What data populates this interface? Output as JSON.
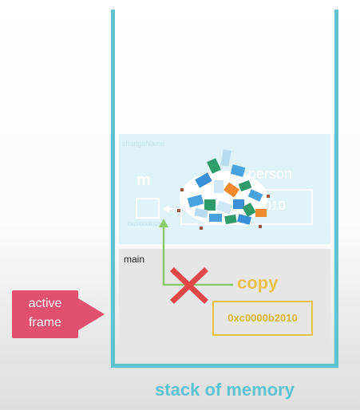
{
  "diagram": {
    "caption": "stack of memory",
    "active_frame_label": "active\nframe",
    "main_frame": {
      "label": "main",
      "variable": "copy",
      "value": "0xc0000b2010"
    },
    "upper_frame": {
      "label": "changeName",
      "param": "m",
      "param_addr": "0xc0000b2010",
      "target": "person",
      "target_value": "0xc0000b2010",
      "target_value_visible": "2010"
    },
    "colors": {
      "stack_wall": "#5fc2d2",
      "upper_frame_bg": "#dcf1f8",
      "main_frame_bg": "#e6e6e6",
      "copy_accent": "#e8c248",
      "active_badge": "#e2506f",
      "cross": "#e04848",
      "pointer_arrow": "#8cc96a"
    },
    "icons": [
      "garbage-pile-icon",
      "cross-icon",
      "pointer-arrow-icon",
      "active-frame-arrow-icon"
    ]
  }
}
